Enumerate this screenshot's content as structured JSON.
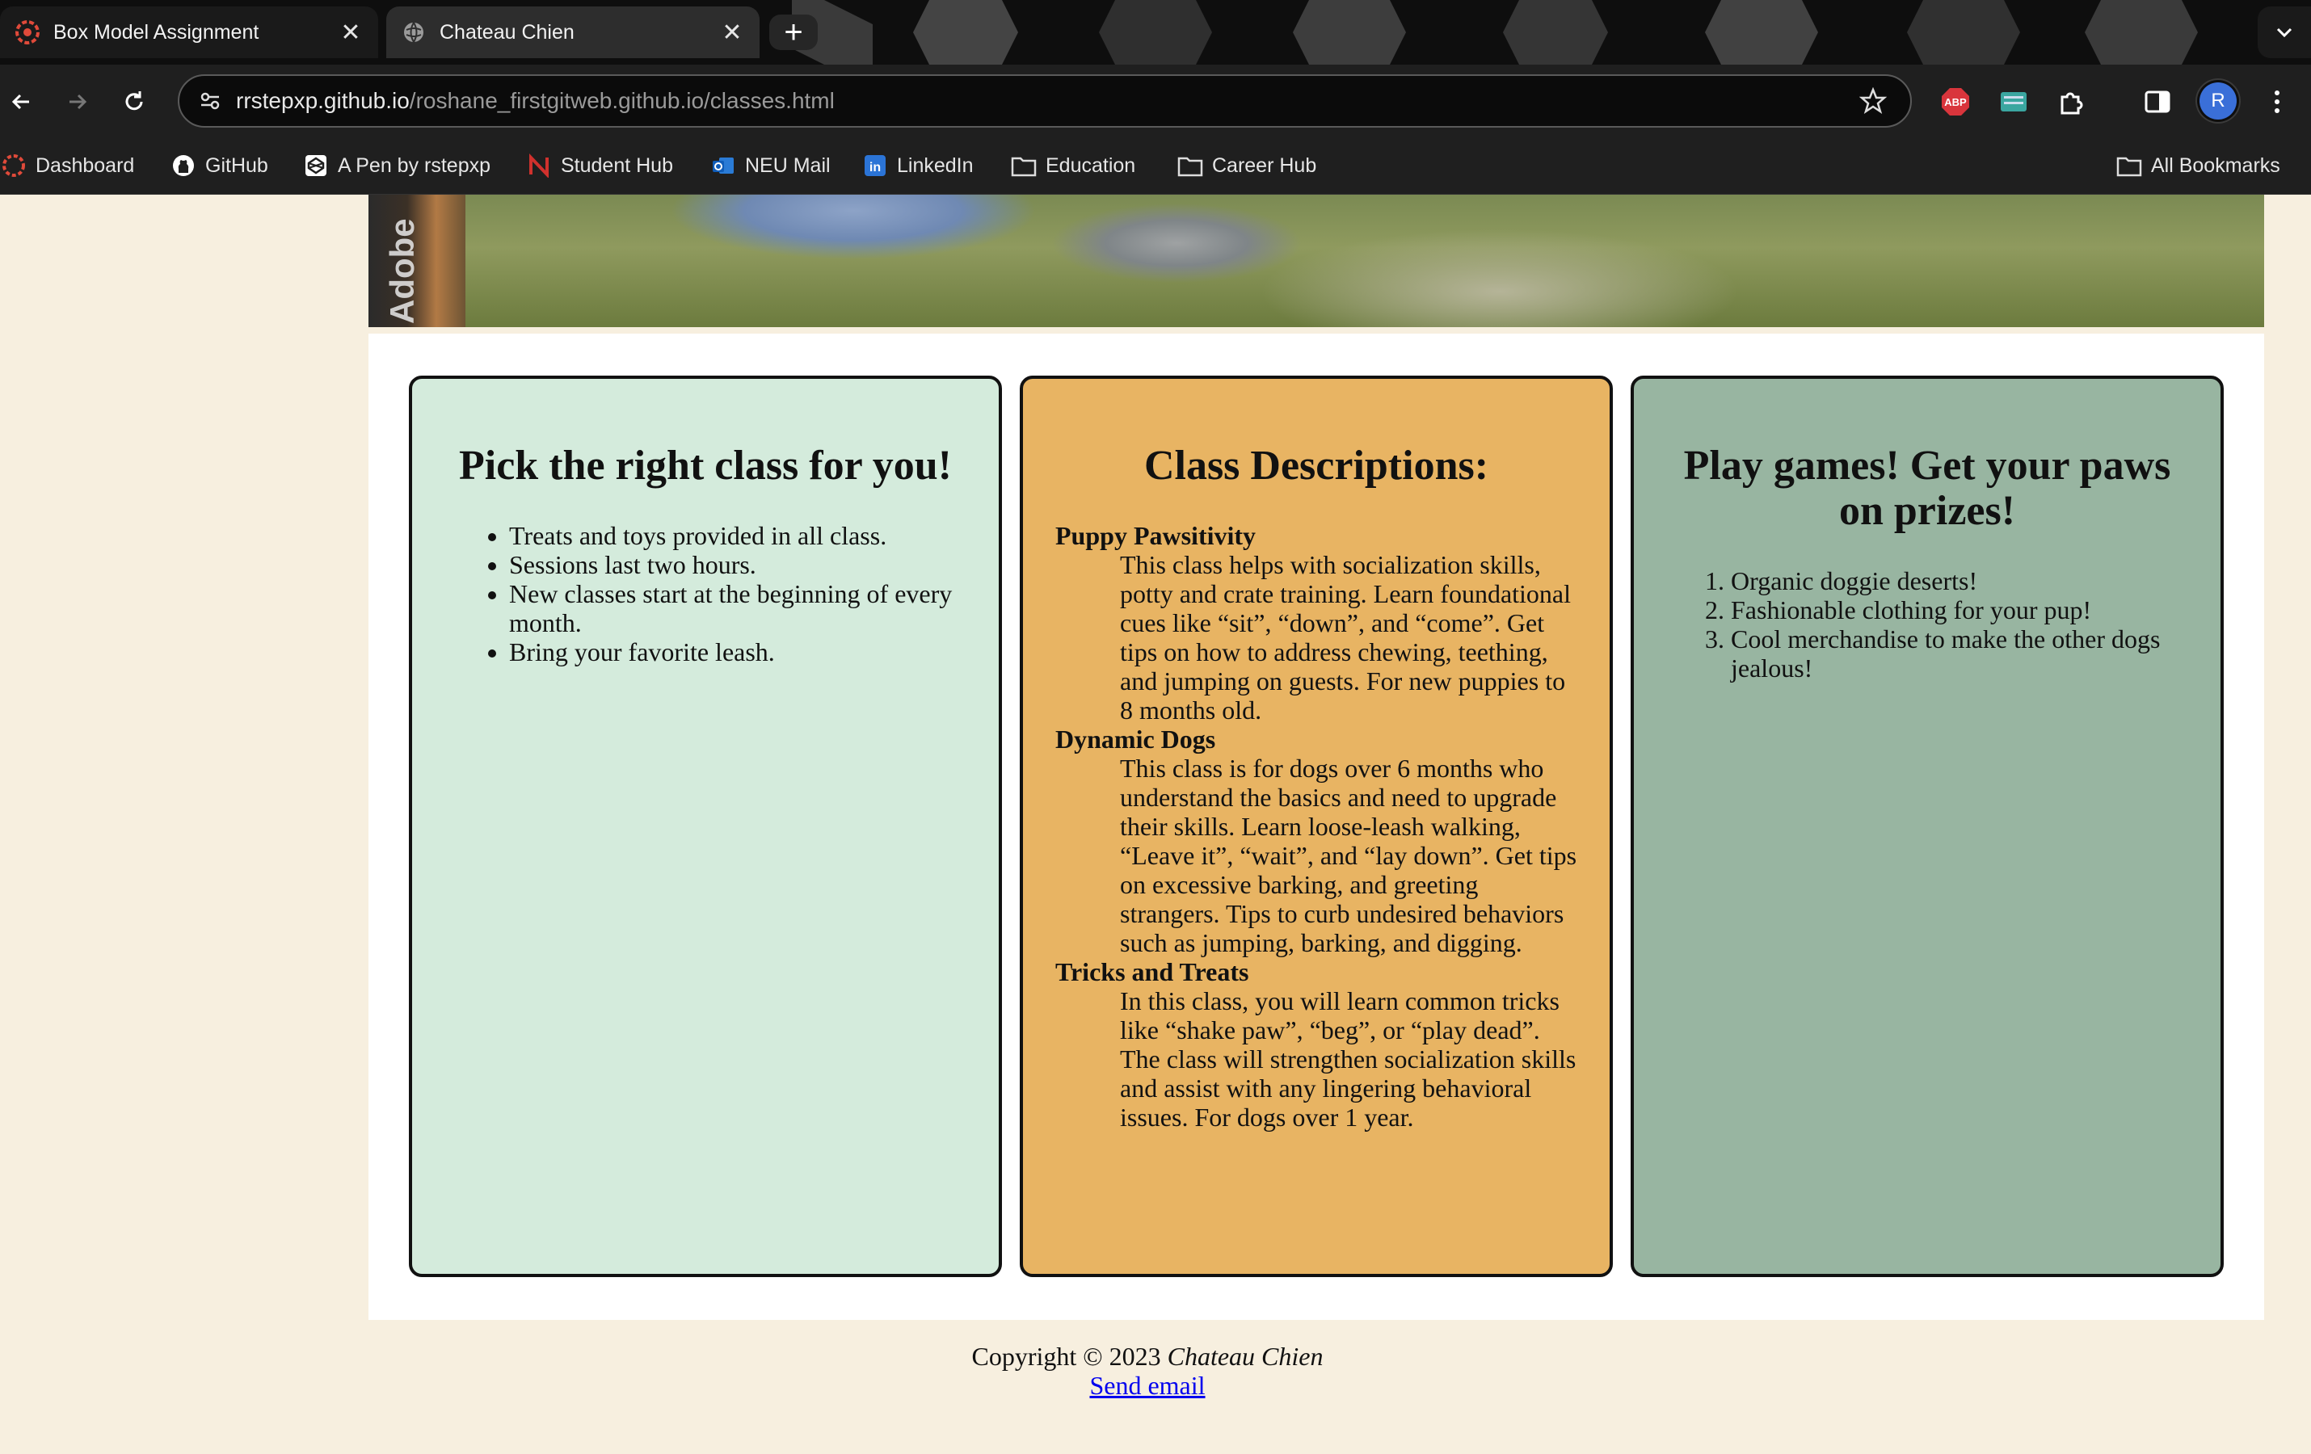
{
  "browser": {
    "tabs": [
      {
        "title": "Box Model Assignment",
        "icon": "codepen-favicon"
      },
      {
        "title": "Chateau Chien",
        "icon": "globe-icon"
      }
    ],
    "address": {
      "host": "rrstepxp.github.io",
      "path": "/roshane_firstgitweb.github.io/classes.html"
    },
    "profile_initial": "R",
    "extensions": [
      "adblock-plus-icon",
      "extension-icon",
      "puzzle-icon"
    ],
    "extension_labels": {
      "abp": "ABP"
    },
    "bookmarks": [
      {
        "label": "Dashboard",
        "icon": "dashboard-icon"
      },
      {
        "label": "GitHub",
        "icon": "github-icon"
      },
      {
        "label": "A Pen by rstepxp",
        "icon": "codepen-icon"
      },
      {
        "label": "Student Hub",
        "icon": "northeastern-icon"
      },
      {
        "label": "NEU Mail",
        "icon": "outlook-icon"
      },
      {
        "label": "LinkedIn",
        "icon": "linkedin-icon"
      },
      {
        "label": "Education",
        "icon": "folder-icon"
      },
      {
        "label": "Career Hub",
        "icon": "folder-icon"
      }
    ],
    "all_bookmarks": "All Bookmarks",
    "colors": {
      "chrome_bg": "#1f1f1f",
      "tabstrip_bg": "#0e0e0e",
      "avatar": "#3a6fd8"
    }
  },
  "page": {
    "hero_watermark": "Adobe",
    "cards": [
      {
        "title": "Pick the right class for you!",
        "items": [
          "Treats and toys provided in all class.",
          "Sessions last two hours.",
          "New classes start at the beginning of every month.",
          "Bring your favorite leash."
        ]
      },
      {
        "title": "Class Descriptions:",
        "classes": [
          {
            "name": "Puppy Pawsitivity",
            "desc": "This class helps with socialization skills, potty and crate training. Learn foundational cues like “sit”, “down”, and “come”. Get tips on how to address chewing, teething, and jumping on guests. For new puppies to 8 months old."
          },
          {
            "name": "Dynamic Dogs",
            "desc": "This class is for dogs over 6 months who understand the basics and need to upgrade their skills. Learn loose-leash walking, “Leave it”, “wait”, and “lay down”. Get tips on excessive barking, and greeting strangers. Tips to curb undesired behaviors such as jumping, barking, and digging."
          },
          {
            "name": "Tricks and Treats",
            "desc": "In this class, you will learn common tricks like “shake paw”, “beg”, or “play dead”. The class will strengthen socialization skills and assist with any lingering behavioral issues. For dogs over 1 year."
          }
        ]
      },
      {
        "title": "Play games! Get your paws on prizes!",
        "items": [
          "Organic doggie deserts!",
          "Fashionable clothing for your pup!",
          "Cool merchandise to make the other dogs jealous!"
        ]
      }
    ],
    "footer": {
      "copyright": "Copyright © 2023",
      "brand": "Chateau Chien",
      "email_link": "Send email"
    },
    "colors": {
      "page_bg": "#f7efdf",
      "card1_bg": "#d4ebdc",
      "card2_bg": "#e8b463",
      "card3_bg": "#98b5a1",
      "link": "#0000ee"
    }
  }
}
